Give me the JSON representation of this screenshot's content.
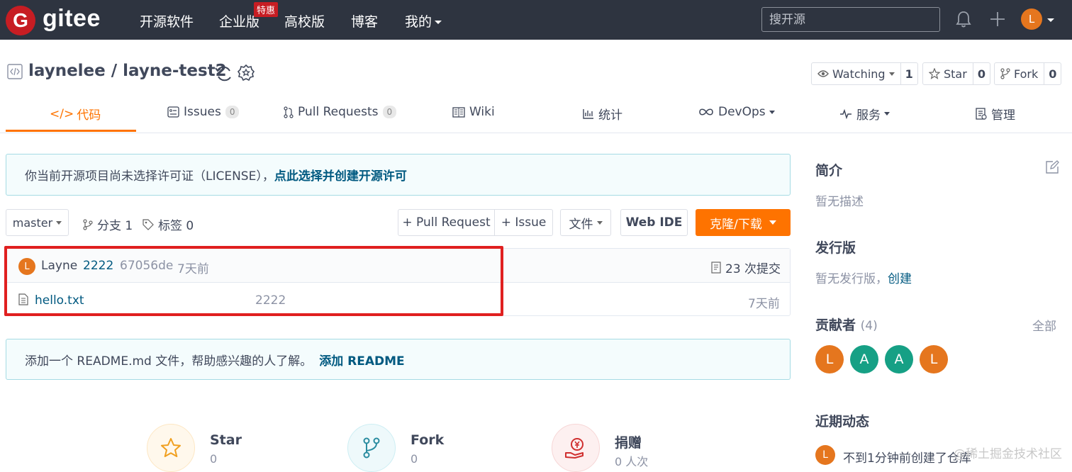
{
  "nav": {
    "logo_letter": "G",
    "brand": "gitee",
    "items": [
      "开源软件",
      "企业版",
      "高校版",
      "博客",
      "我的"
    ],
    "badge": "特惠",
    "search_placeholder": "搜开源",
    "avatar_letter": "L"
  },
  "repo": {
    "title": "laynelee / layne-test2",
    "watch_label": "Watching",
    "watch_count": "1",
    "star_label": "Star",
    "star_count": "0",
    "fork_label": "Fork",
    "fork_count": "0"
  },
  "tabs": {
    "code": "代码",
    "issues": "Issues",
    "issues_count": "0",
    "pulls": "Pull Requests",
    "pulls_count": "0",
    "wiki": "Wiki",
    "stats": "统计",
    "devops": "DevOps",
    "service": "服务",
    "manage": "管理"
  },
  "license_notice": {
    "text": "你当前开源项目尚未选择许可证（LICENSE），",
    "link": "点此选择并创建开源许可"
  },
  "toolbar": {
    "branch": "master",
    "branches": "分支 1",
    "tags": "标签 0",
    "pull_request": "+ Pull Request",
    "issue": "+ Issue",
    "file": "文件",
    "web_ide": "Web IDE",
    "clone": "克隆/下载"
  },
  "commit": {
    "avatar_letter": "L",
    "author": "Layne",
    "message": "2222",
    "hash": "67056de",
    "time": "7天前",
    "count_text": "23 次提交"
  },
  "files": [
    {
      "name": "hello.txt",
      "message": "2222",
      "time": "7天前"
    }
  ],
  "readme_notice": {
    "text": "添加一个 README.md 文件，帮助感兴趣的人了解。",
    "link": "添加 README"
  },
  "stats": {
    "star_label": "Star",
    "star_value": "0",
    "fork_label": "Fork",
    "fork_value": "0",
    "donate_label": "捐赠",
    "donate_value": "0 人次"
  },
  "sidebar": {
    "intro_title": "简介",
    "intro_text": "暂无描述",
    "release_title": "发行版",
    "release_text": "暂无发行版，",
    "release_link": "创建",
    "contrib_title": "贡献者",
    "contrib_count": "(4)",
    "contrib_all": "全部",
    "contributors": [
      "L",
      "A",
      "A",
      "L"
    ],
    "activity_title": "近期动态",
    "activity_avatar": "L",
    "activity_text": "不到1分钟前创建了仓库"
  },
  "watermark": "@稀土掘金技术社区",
  "colors": {
    "nav_bg": "#2e3440",
    "accent": "#fe7300",
    "brand_red": "#c71d23",
    "link": "#005980",
    "contrib_orange": "#e5761e",
    "contrib_teal": "#16a085",
    "highlight_box": "#e02020"
  }
}
